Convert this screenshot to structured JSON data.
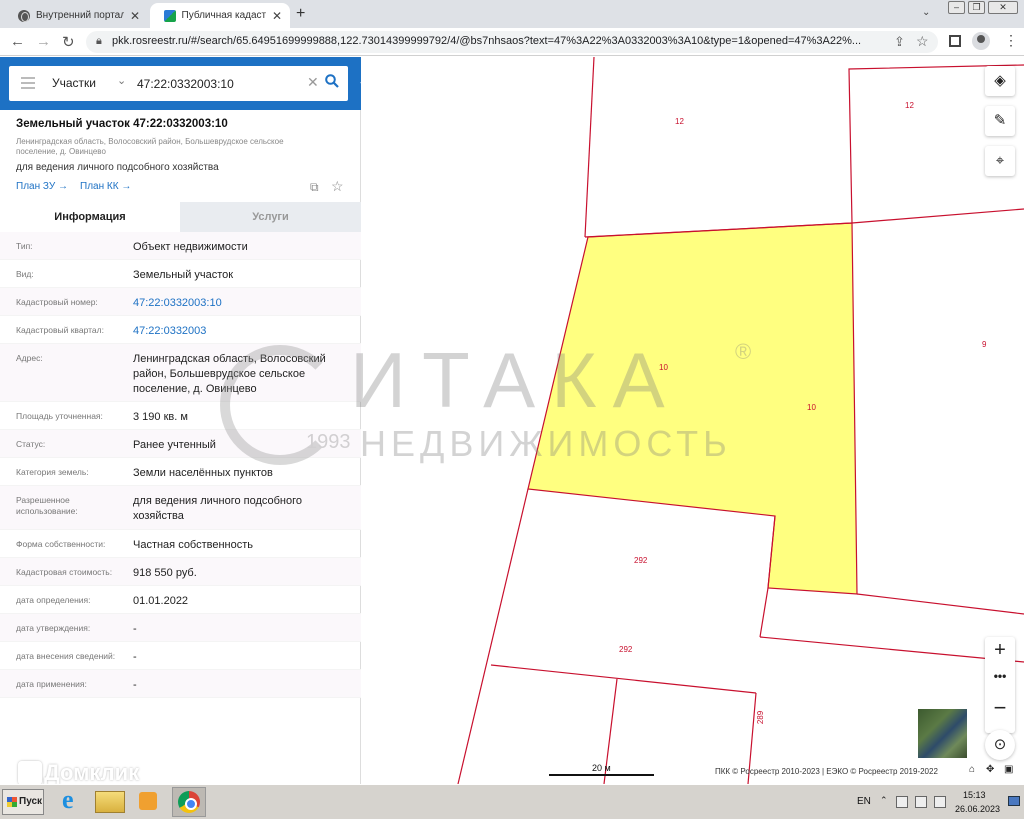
{
  "browser": {
    "tabs": [
      {
        "title": "Внутренний портал - Д",
        "active": false,
        "icon": "globe-icon"
      },
      {
        "title": "Публичная кадастрс",
        "active": true,
        "icon": "pkk-favicon"
      }
    ],
    "url": "pkk.rosreestr.ru/#/search/65.64951699999888,122.73014399999792/4/@bs7nhsaos?text=47%3A22%3A0332003%3A10&type=1&opened=47%3A22%..."
  },
  "search": {
    "type": "Участки",
    "query": "47:22:0332003:10"
  },
  "parcel": {
    "title": "Земельный участок 47:22:0332003:10",
    "address": "Ленинградская область, Волосовский район, Большеврудское сельское поселение, д. Овинцево",
    "purpose": "для ведения личного подсобного хозяйства",
    "links": [
      "План ЗУ →",
      "План КК →"
    ]
  },
  "tabs": {
    "info": "Информация",
    "services": "Услуги"
  },
  "rows": [
    {
      "k": "Тип:",
      "v": "Объект недвижимости",
      "link": false
    },
    {
      "k": "Вид:",
      "v": "Земельный участок",
      "link": false
    },
    {
      "k": "Кадастровый номер:",
      "v": "47:22:0332003:10",
      "link": true
    },
    {
      "k": "Кадастровый квартал:",
      "v": "47:22:0332003",
      "link": true
    },
    {
      "k": "Адрес:",
      "v": "Ленинградская область, Волосовский район, Большеврудское сельское поселение, д. Овинцево",
      "link": false
    },
    {
      "k": "Площадь уточненная:",
      "v": "3 190 кв. м",
      "link": false
    },
    {
      "k": "Статус:",
      "v": "Ранее учтенный",
      "link": false
    },
    {
      "k": "Категория земель:",
      "v": "Земли населённых пунктов",
      "link": false
    },
    {
      "k": "Разрешенное использование:",
      "v": "для ведения личного подсобного хозяйства",
      "link": false
    },
    {
      "k": "Форма собственности:",
      "v": "Частная собственность",
      "link": false
    },
    {
      "k": "Кадастровая стоимость:",
      "v": "918 550 руб.",
      "link": false
    },
    {
      "k": "дата определения:",
      "v": "01.01.2022",
      "link": false
    },
    {
      "k": "дата утверждения:",
      "v": "-",
      "link": false
    },
    {
      "k": "дата внесения сведений:",
      "v": "-",
      "link": false
    },
    {
      "k": "дата применения:",
      "v": "-",
      "link": false
    }
  ],
  "map": {
    "labels": [
      "12",
      "12",
      "10",
      "10",
      "9",
      "292",
      "292",
      "289"
    ],
    "scale": "20 м",
    "copyright": "ПКК © Росреестр 2010-2023 | ЕЭКО © Росреестр 2019-2022",
    "parcel_color": "#ffff80",
    "boundary_color": "#c8102e"
  },
  "watermark": {
    "name": "ИТАКА",
    "reg": "®",
    "sub": "НЕДВИЖИМОСТЬ",
    "year": "1993",
    "domclick": "Домклик"
  },
  "taskbar": {
    "start": "Пуск",
    "lang": "EN",
    "time": "15:13",
    "date": "26.06.2023"
  }
}
